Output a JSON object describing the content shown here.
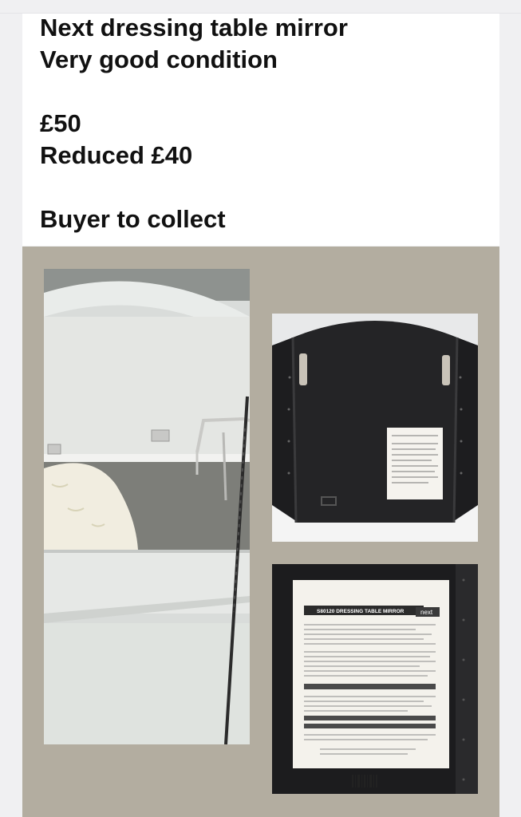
{
  "post": {
    "line1": "Next dressing table mirror",
    "line2": "Very good condition",
    "price_original": "£50",
    "price_reduced": "Reduced £40",
    "collection_note": "Buyer to collect"
  },
  "photos": [
    {
      "name": "mirror-front-photo",
      "subject": "mirror front reflecting bedroom"
    },
    {
      "name": "mirror-back-photo",
      "subject": "black back of tri-fold mirror with label"
    },
    {
      "name": "mirror-label-photo",
      "subject": "close-up of product label"
    }
  ],
  "label": {
    "title": "S80120 DRESSING TABLE MIRROR",
    "brand": "next"
  },
  "colors": {
    "panel_background": "#b3ada0",
    "card_background": "#ffffff",
    "text": "#111111"
  }
}
